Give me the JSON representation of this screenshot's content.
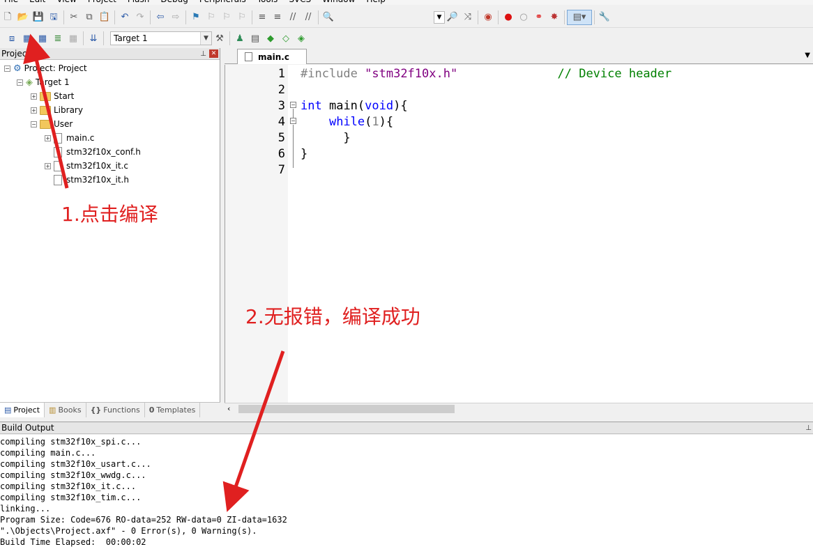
{
  "menu": [
    "File",
    "Edit",
    "View",
    "Project",
    "Flash",
    "Debug",
    "Peripherals",
    "Tools",
    "SVCS",
    "Window",
    "Help"
  ],
  "toolbar2": {
    "target_value": "Target 1"
  },
  "project_panel": {
    "title": "Project",
    "tree": [
      {
        "label": "Project: Project",
        "level": 0,
        "expander": "−"
      },
      {
        "label": "Target 1",
        "level": 1,
        "expander": "−"
      },
      {
        "label": "Start",
        "level": 2,
        "expander": "+"
      },
      {
        "label": "Library",
        "level": 2,
        "expander": "+"
      },
      {
        "label": "User",
        "level": 2,
        "expander": "−"
      },
      {
        "label": "main.c",
        "level": 3,
        "expander": "+"
      },
      {
        "label": "stm32f10x_conf.h",
        "level": 3,
        "expander": ""
      },
      {
        "label": "stm32f10x_it.c",
        "level": 3,
        "expander": "+"
      },
      {
        "label": "stm32f10x_it.h",
        "level": 3,
        "expander": ""
      }
    ],
    "tabs": [
      {
        "label": "Project",
        "icon": "project-icon"
      },
      {
        "label": "Books",
        "icon": "books-icon"
      },
      {
        "label": "Functions",
        "icon": "functions-icon",
        "glyph": "{}"
      },
      {
        "label": "Templates",
        "icon": "templates-icon",
        "glyph": "0"
      }
    ]
  },
  "editor": {
    "tab": "main.c",
    "line_numbers": [
      "1",
      "2",
      "3",
      "4",
      "5",
      "6",
      "7"
    ],
    "code": {
      "l1_pp": "#include",
      "l1_str": "\"stm32f10x.h\"",
      "l1_cmt": "// Device header",
      "l3_kw": "int",
      "l3_fn": "main",
      "l3_p1": "(",
      "l3_kw2": "void",
      "l3_p2": "){",
      "l4_kw": "while",
      "l4_p1": "(",
      "l4_num": "1",
      "l4_p2": "){",
      "l5": "}",
      "l6": "}"
    }
  },
  "build_output": {
    "title": "Build Output",
    "lines": [
      "compiling stm32f10x_spi.c...",
      "compiling main.c...",
      "compiling stm32f10x_usart.c...",
      "compiling stm32f10x_wwdg.c...",
      "compiling stm32f10x_it.c...",
      "compiling stm32f10x_tim.c...",
      "linking...",
      "Program Size: Code=676 RO-data=252 RW-data=0 ZI-data=1632",
      "\".\\Objects\\Project.axf\" - 0 Error(s), 0 Warning(s).",
      "Build Time Elapsed:  00:00:02"
    ]
  },
  "annotations": {
    "step1": "1.点击编译",
    "step2": "2.无报错，编译成功",
    "color": "#e02020"
  }
}
